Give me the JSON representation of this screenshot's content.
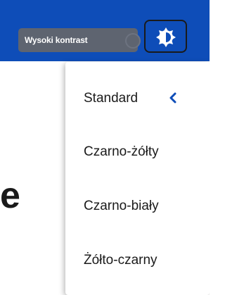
{
  "header": {
    "high_contrast_label": "Wysoki kontrast",
    "contrast_button_icon": "contrast-gear-icon"
  },
  "background": {
    "partial_heading_char": "e"
  },
  "contrast_menu": {
    "items": [
      {
        "label": "Standard",
        "selected": true
      },
      {
        "label": "Czarno-żółty",
        "selected": false
      },
      {
        "label": "Czarno-biały",
        "selected": false
      },
      {
        "label": "Żółto-czarny",
        "selected": false
      }
    ],
    "selected_indicator_icon": "chevron-left-icon"
  },
  "colors": {
    "header_bg": "#0e4db8",
    "label_bg": "#5e6470",
    "accent": "#0e4db8",
    "text": "#1a1a1a"
  }
}
